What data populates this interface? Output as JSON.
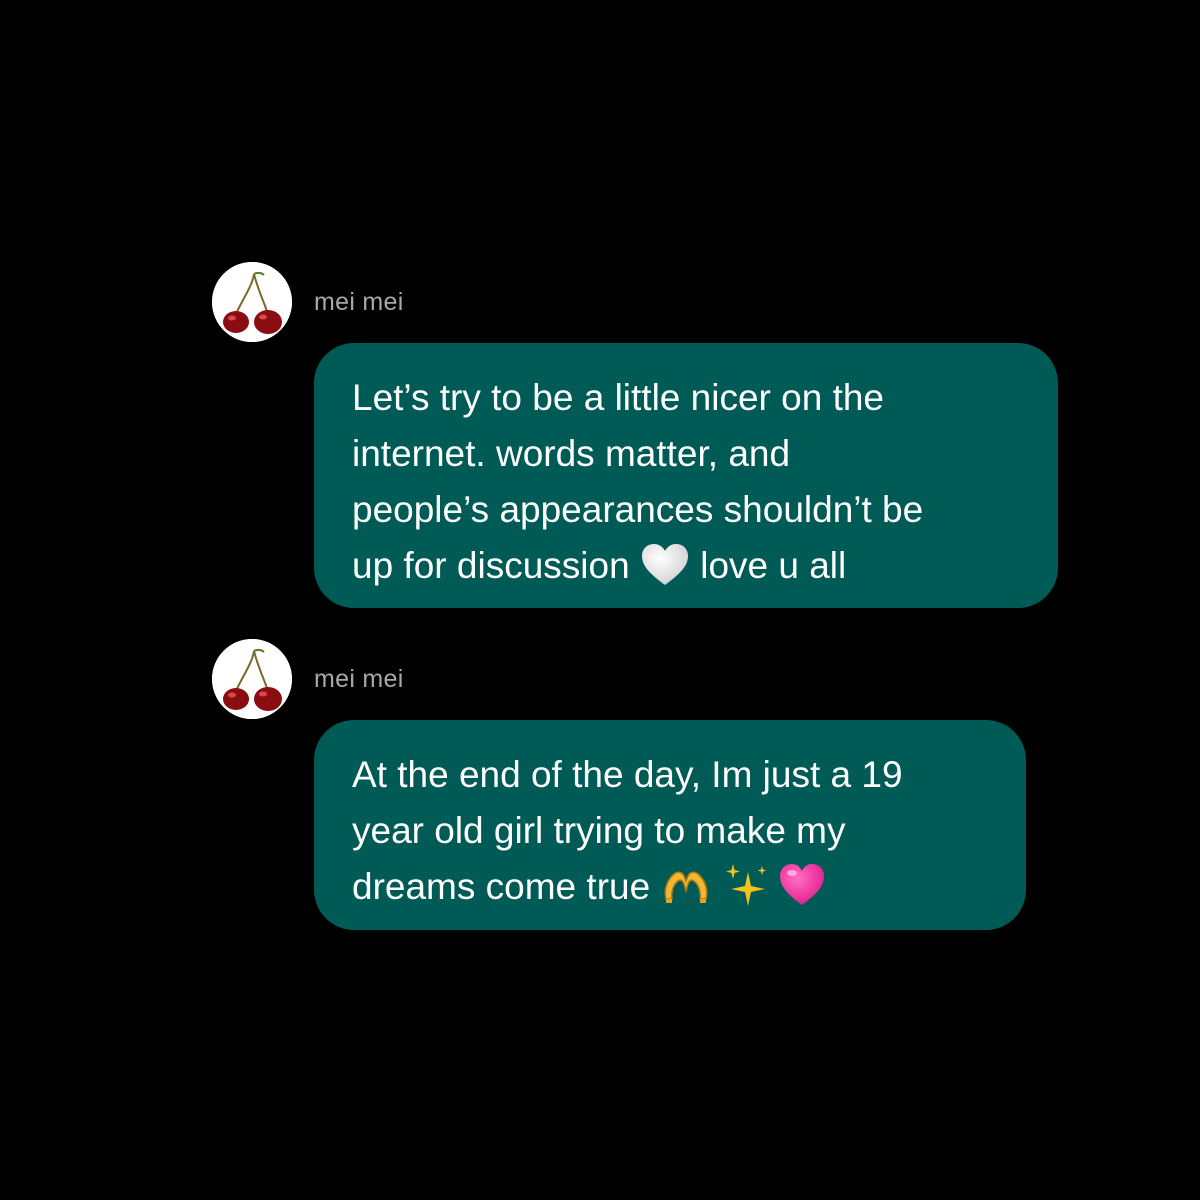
{
  "messages": [
    {
      "sender": "mei mei",
      "lines": [
        "Let’s try to be a little nicer on the",
        "internet. words matter, and",
        "people’s appearances shouldn’t be"
      ],
      "last_line_before_emoji": "up for discussion ",
      "last_line_after_emoji": " love u all",
      "emoji": [
        "white-heart-icon"
      ]
    },
    {
      "sender": "mei mei",
      "lines": [
        "At the end of the day, Im just a 19",
        "year old girl trying to make my"
      ],
      "last_line_before_emoji": "dreams come true ",
      "emoji": [
        "heart-hands-icon",
        "sparkles-icon",
        "pink-heart-icon"
      ]
    }
  ],
  "colors": {
    "background": "#000000",
    "bubble": "#005a55",
    "sender_name": "#a8a8a8",
    "text": "#ffffff"
  }
}
